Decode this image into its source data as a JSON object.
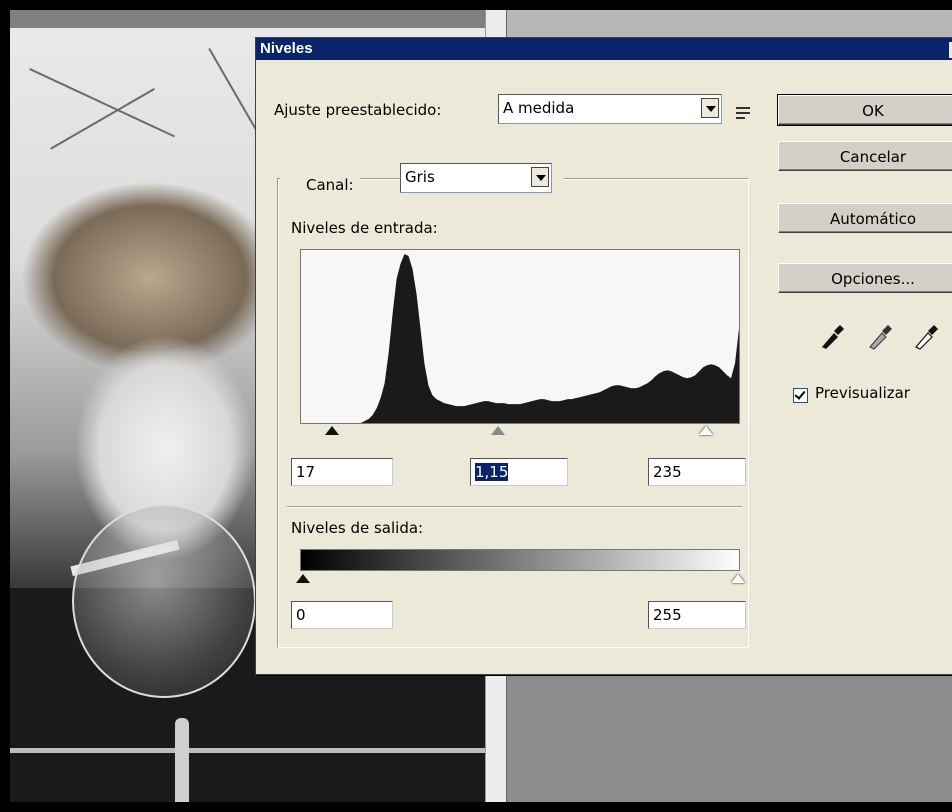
{
  "dialog": {
    "title": "Niveles",
    "preset_label": "Ajuste preestablecido:",
    "preset_value": "A medida",
    "channel_label": "Canal:",
    "channel_value": "Gris",
    "input_levels_label": "Niveles de entrada:",
    "input_black": "17",
    "input_gamma": "1,15",
    "input_white": "235",
    "output_levels_label": "Niveles de salida:",
    "output_black": "0",
    "output_white": "255",
    "buttons": {
      "ok": "OK",
      "cancel": "Cancelar",
      "auto": "Automático",
      "options": "Opciones..."
    },
    "preview_label": "Previsualizar",
    "preview_checked": true
  },
  "histogram": [
    0,
    0,
    0,
    0,
    0,
    0,
    0,
    0,
    0,
    0,
    0,
    0,
    0,
    0,
    0,
    0,
    2,
    4,
    8,
    15,
    25,
    40,
    70,
    110,
    145,
    160,
    170,
    168,
    155,
    130,
    95,
    60,
    38,
    28,
    24,
    22,
    20,
    19,
    18,
    17,
    17,
    17,
    18,
    19,
    20,
    21,
    22,
    22,
    21,
    20,
    20,
    20,
    19,
    19,
    19,
    19,
    20,
    21,
    22,
    23,
    24,
    24,
    23,
    22,
    22,
    22,
    23,
    24,
    24,
    25,
    26,
    27,
    28,
    29,
    30,
    31,
    33,
    35,
    37,
    38,
    38,
    37,
    36,
    35,
    35,
    36,
    38,
    40,
    43,
    47,
    50,
    52,
    53,
    52,
    50,
    48,
    46,
    45,
    46,
    48,
    52,
    56,
    58,
    59,
    58,
    56,
    52,
    48,
    45,
    60,
    95
  ],
  "colors": {
    "titlebar": "#0a246a",
    "dialog_bg": "#ece9d8",
    "histogram_fill": "#1a1a1a"
  }
}
